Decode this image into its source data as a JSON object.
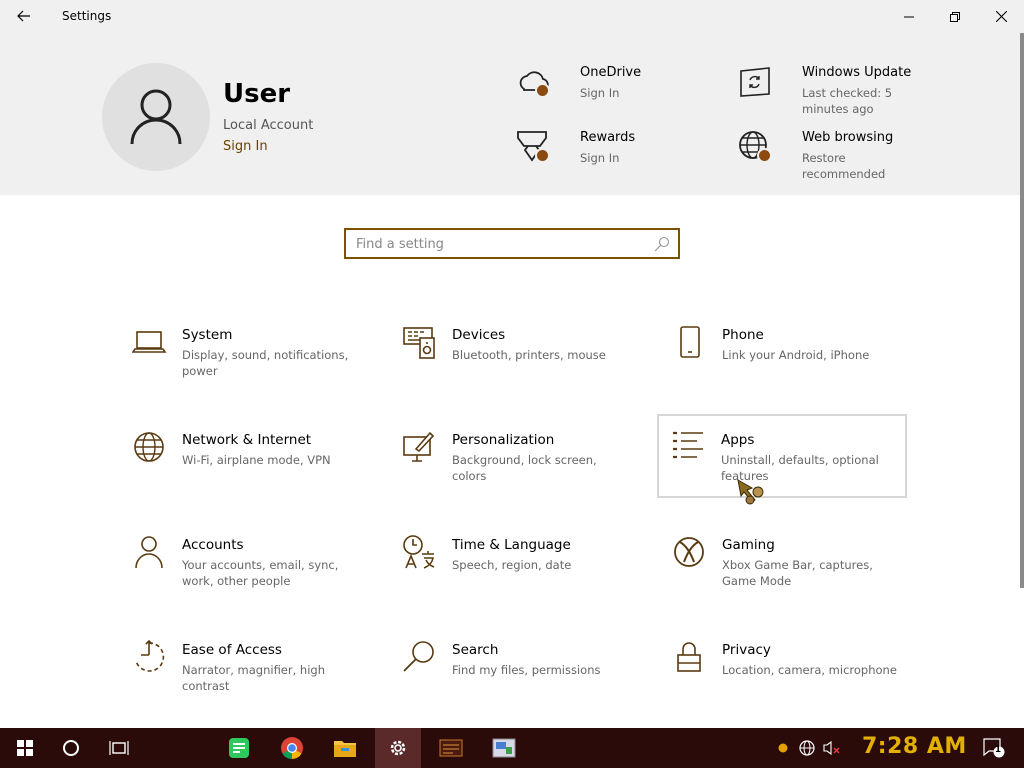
{
  "window": {
    "title": "Settings",
    "back_icon": "back-arrow-icon",
    "minimize_icon": "minimize-icon",
    "maximize_icon": "maximize-icon",
    "close_icon": "close-icon"
  },
  "profile": {
    "name": "User",
    "account_type": "Local Account",
    "sign_in": "Sign In",
    "avatar_icon": "person-icon"
  },
  "header_items": [
    {
      "title": "OneDrive",
      "subtitle": "Sign In",
      "icon": "cloud-icon"
    },
    {
      "title": "Windows Update",
      "subtitle": "Last checked: 5 minutes ago",
      "icon": "update-icon"
    },
    {
      "title": "Rewards",
      "subtitle": "Sign In",
      "icon": "trophy-icon"
    },
    {
      "title": "Web browsing",
      "subtitle": "Restore recommended",
      "icon": "globe-icon"
    }
  ],
  "search": {
    "placeholder": "Find a setting",
    "value": ""
  },
  "categories": [
    {
      "title": "System",
      "subtitle": "Display, sound, notifications, power",
      "icon": "laptop-icon"
    },
    {
      "title": "Devices",
      "subtitle": "Bluetooth, printers, mouse",
      "icon": "devices-icon"
    },
    {
      "title": "Phone",
      "subtitle": "Link your Android, iPhone",
      "icon": "phone-icon"
    },
    {
      "title": "Network & Internet",
      "subtitle": "Wi-Fi, airplane mode, VPN",
      "icon": "globe-icon"
    },
    {
      "title": "Personalization",
      "subtitle": "Background, lock screen, colors",
      "icon": "paintbrush-icon"
    },
    {
      "title": "Apps",
      "subtitle": "Uninstall, defaults, optional features",
      "icon": "apps-list-icon"
    },
    {
      "title": "Accounts",
      "subtitle": "Your accounts, email, sync, work, other people",
      "icon": "person-icon"
    },
    {
      "title": "Time & Language",
      "subtitle": "Speech, region, date",
      "icon": "time-language-icon"
    },
    {
      "title": "Gaming",
      "subtitle": "Xbox Game Bar, captures, Game Mode",
      "icon": "xbox-icon"
    },
    {
      "title": "Ease of Access",
      "subtitle": "Narrator, magnifier, high contrast",
      "icon": "ease-of-access-icon"
    },
    {
      "title": "Search",
      "subtitle": "Find my files, permissions",
      "icon": "search-icon"
    },
    {
      "title": "Privacy",
      "subtitle": "Location, camera, microphone",
      "icon": "lock-icon"
    }
  ],
  "taskbar": {
    "clock": "7:28 AM",
    "notification_count": "1",
    "apps": [
      "start-icon",
      "cortana-icon",
      "task-view-icon",
      "notes-icon",
      "chrome-icon",
      "file-explorer-icon",
      "settings-icon",
      "app-icon",
      "app-icon"
    ]
  },
  "colors": {
    "accent": "#7a5200",
    "badge": "#8a4a10",
    "header_bg": "#f0f0f0",
    "taskbar_bg": "#2b0a0a",
    "clock": "#e2b100"
  }
}
